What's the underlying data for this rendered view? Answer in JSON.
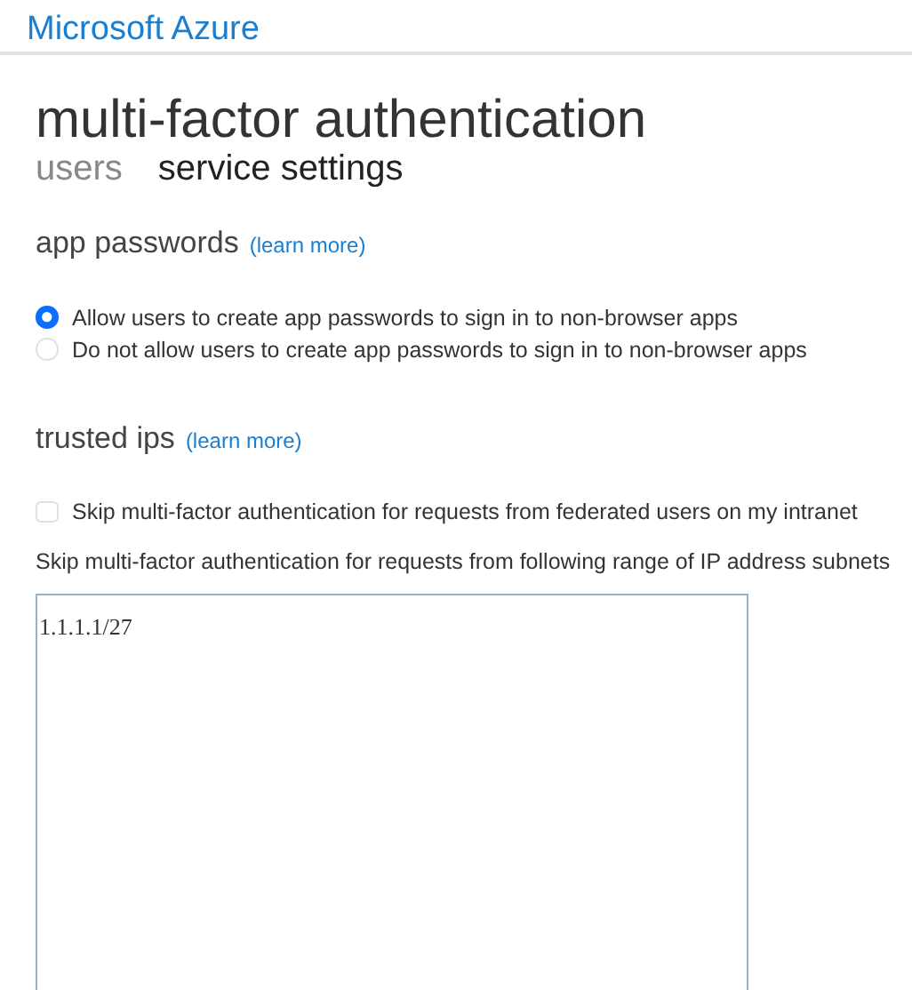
{
  "header": {
    "brand": "Microsoft Azure"
  },
  "page_title": "multi-factor authentication",
  "tabs": [
    {
      "label": "users",
      "selected": false
    },
    {
      "label": "service settings",
      "selected": true
    }
  ],
  "sections": [
    {
      "title": "app passwords",
      "link": "(learn more)",
      "options": [
        {
          "kind": "radio",
          "label": "Allow users to create app passwords to sign in to non-browser apps",
          "selected": true
        },
        {
          "kind": "radio",
          "label": "Do not allow users to create app passwords to sign in to non-browser apps",
          "selected": false
        }
      ]
    },
    {
      "title": "trusted ips",
      "link": "(learn more)",
      "options": [
        {
          "kind": "checkbox",
          "label": "Skip multi-factor authentication for requests from federated users on my intranet",
          "checked": false
        },
        {
          "kind": "textarea",
          "label": "Skip multi-factor authentication for requests from following range of IP address subnets",
          "value": "1.1.1.1/27"
        }
      ]
    }
  ]
}
